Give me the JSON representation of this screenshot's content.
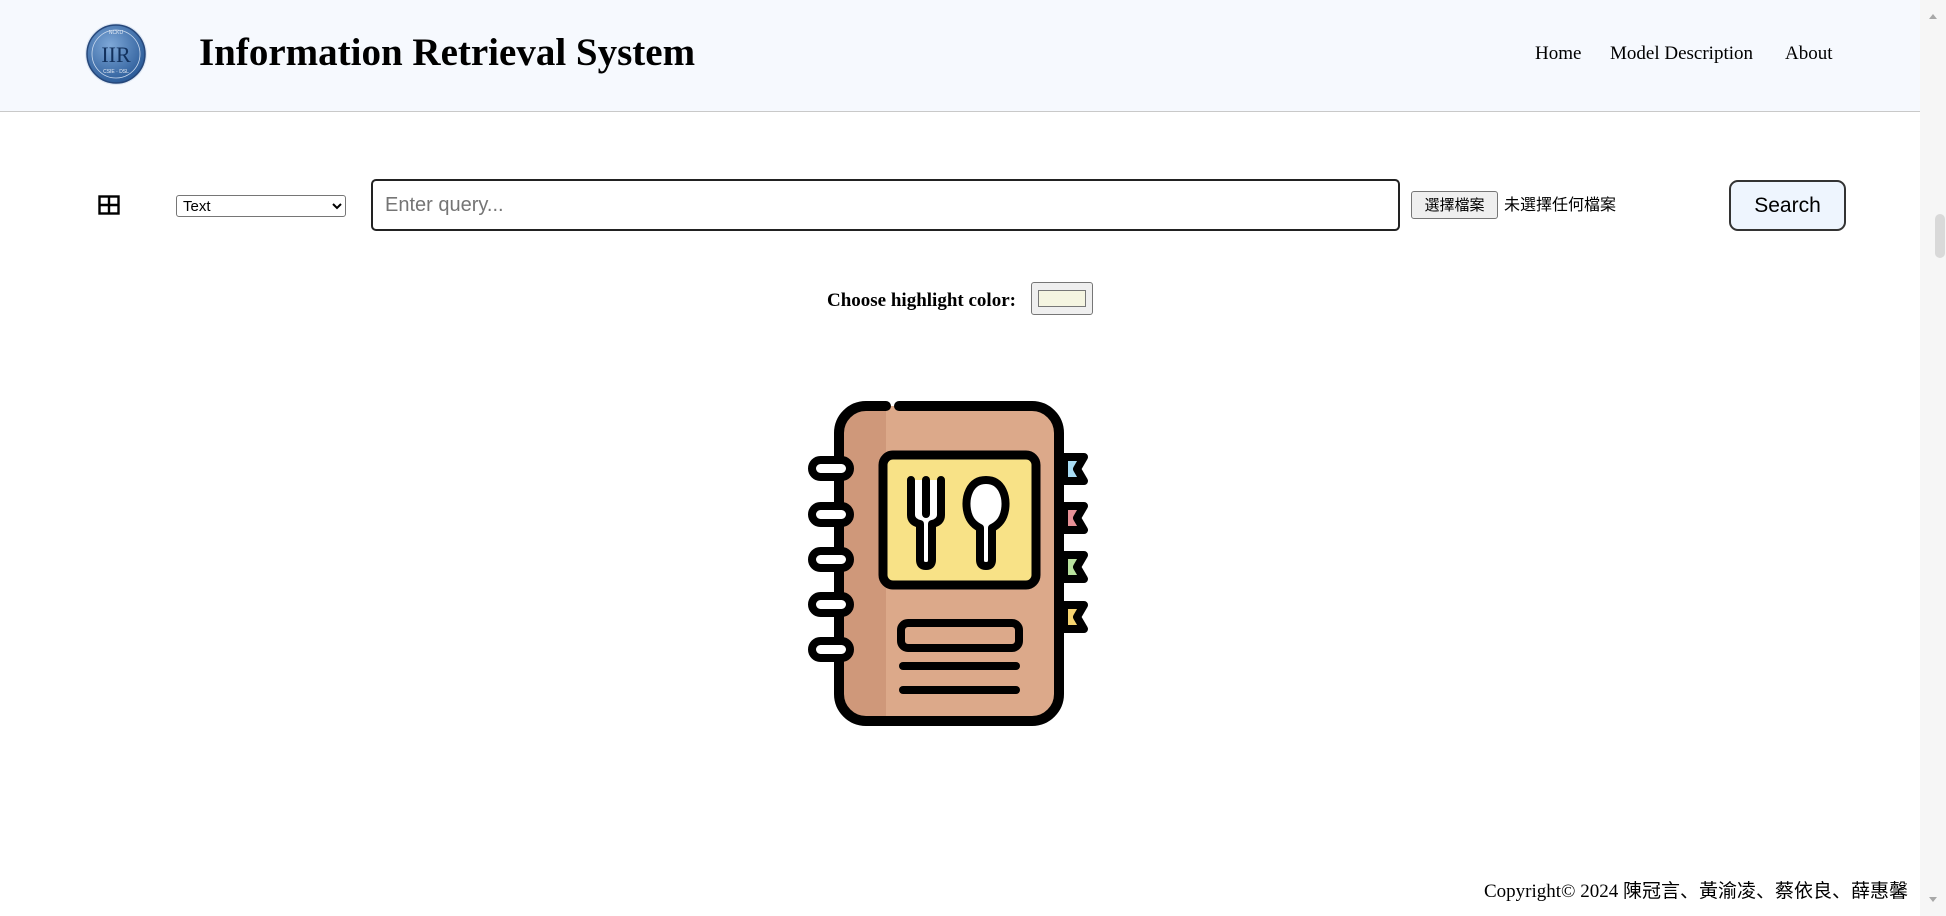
{
  "header": {
    "title": "Information Retrieval System",
    "logo": {
      "text": "IIR",
      "subtext": "CSIE · DSL",
      "toptext": "NCKU"
    },
    "nav": {
      "home": "Home",
      "model_description": "Model Description",
      "about": "About"
    }
  },
  "search": {
    "mode_selected": "Text",
    "query_placeholder": "Enter query...",
    "query_value": "",
    "file_button_label": "選擇檔案",
    "file_status": "未選擇任何檔案",
    "search_button_label": "Search"
  },
  "highlight": {
    "label": "Choose highlight color:",
    "color": "#f5f5e1"
  },
  "illustration": {
    "icon": "menu-book-icon"
  },
  "footer": {
    "copyright_prefix": "Copyright© 2024 ",
    "authors": "陳冠言、黃渝凌、蔡依良、薛惠馨"
  },
  "colors": {
    "header_bg": "#f6f9fe",
    "search_button_bg": "#eef5fe",
    "book_cover": "#dca98a",
    "book_panel": "#f8e287",
    "tab_blue": "#a8dcf4",
    "tab_pink": "#e69096",
    "tab_green": "#b8e29e",
    "tab_yellow": "#f6d470"
  }
}
